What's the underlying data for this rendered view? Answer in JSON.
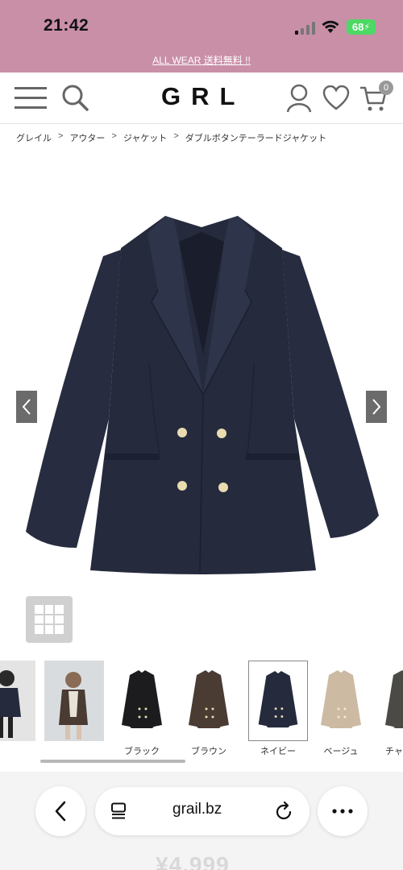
{
  "status": {
    "time": "21:42",
    "battery": "68"
  },
  "promo": {
    "text": "ALL WEAR 送料無料 !!"
  },
  "header": {
    "logo": "GRL",
    "cart_count": "0"
  },
  "breadcrumb": [
    "グレイル",
    "アウター",
    "ジャケット",
    "ダブルボタンテーラードジャケット"
  ],
  "breadcrumb_sep": ">",
  "thumbnails": [
    {
      "label": "",
      "icon": "model-photo"
    },
    {
      "label": "",
      "icon": "model-photo"
    },
    {
      "label": "ブラック",
      "color": "#1c1c1e"
    },
    {
      "label": "ブラウン",
      "color": "#4a3b33"
    },
    {
      "label": "ネイビー",
      "color": "#252a3d",
      "selected": true
    },
    {
      "label": "ベージュ",
      "color": "#cdbaa3"
    },
    {
      "label": "チャ",
      "color": "#4b4a44"
    }
  ],
  "browser": {
    "url": "grail.bz"
  },
  "price_peek": "¥4,999",
  "colors": {
    "promo_bg": "#c98fa7",
    "jacket": "#252a3d",
    "button_gold": "#e8dcb0"
  }
}
